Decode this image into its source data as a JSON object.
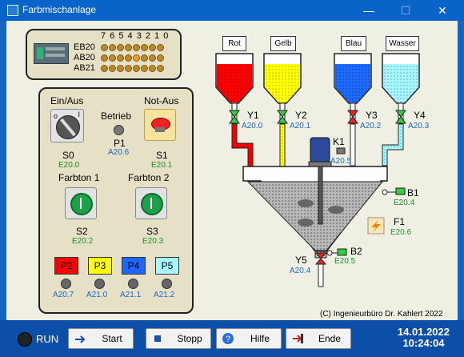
{
  "window": {
    "title": "Farbmischanlage"
  },
  "plc": {
    "bit_header": "7 6 5 4 3 2 1 0",
    "rows": [
      {
        "label": "EB20",
        "bits": [
          0,
          0,
          0,
          0,
          0,
          0,
          0,
          0
        ]
      },
      {
        "label": "AB20",
        "bits": [
          0,
          0,
          0,
          0,
          1,
          0,
          0,
          0
        ]
      },
      {
        "label": "AB21",
        "bits": [
          0,
          0,
          0,
          0,
          0,
          0,
          0,
          0
        ]
      }
    ]
  },
  "control": {
    "ein_aus_label": "Ein/Aus",
    "notaus_label": "Not-Aus",
    "betrieb_label": "Betrieb",
    "s0_label": "S0",
    "s0_addr": "E20.0",
    "p1_label": "P1",
    "p1_addr": "A20.6",
    "s1_label": "S1",
    "s1_addr": "E20.1",
    "farbton1_label": "Farbton 1",
    "farbton2_label": "Farbton 2",
    "s2_label": "S2",
    "s2_addr": "E20.2",
    "s3_label": "S3",
    "s3_addr": "E20.3",
    "p_lamps": [
      {
        "label": "P2",
        "addr": "A20.7",
        "color": "#ff0000"
      },
      {
        "label": "P3",
        "addr": "A21.0",
        "color": "#ffff00"
      },
      {
        "label": "P4",
        "addr": "A21.1",
        "color": "#1e66ff"
      },
      {
        "label": "P5",
        "addr": "A21.2",
        "color": "#a6f7ff"
      }
    ]
  },
  "process": {
    "tanks": [
      {
        "name": "Rot",
        "color": "#ff0000"
      },
      {
        "name": "Gelb",
        "color": "#ffff00"
      },
      {
        "name": "Blau",
        "color": "#1e6bff"
      },
      {
        "name": "Wasser",
        "color": "#aaf6ff"
      }
    ],
    "valves": [
      {
        "label": "Y1",
        "addr": "A20.0"
      },
      {
        "label": "Y2",
        "addr": "A20.1"
      },
      {
        "label": "Y3",
        "addr": "A20.2"
      },
      {
        "label": "Y4",
        "addr": "A20.3"
      }
    ],
    "k1_label": "K1",
    "k1_addr": "A20.5",
    "b1_label": "B1",
    "b1_addr": "E20.4",
    "f1_label": "F1",
    "f1_addr": "E20.6",
    "y5_label": "Y5",
    "y5_addr": "A20.4",
    "b2_label": "B2",
    "b2_addr": "E20.5",
    "copyright": "(C) Ingenieurbüro Dr. Kahlert 2022"
  },
  "toolbar": {
    "run_label": "RUN",
    "start": "Start",
    "stopp": "Stopp",
    "hilfe": "Hilfe",
    "ende": "Ende",
    "date": "14.01.2022",
    "time": "10:24:04"
  }
}
